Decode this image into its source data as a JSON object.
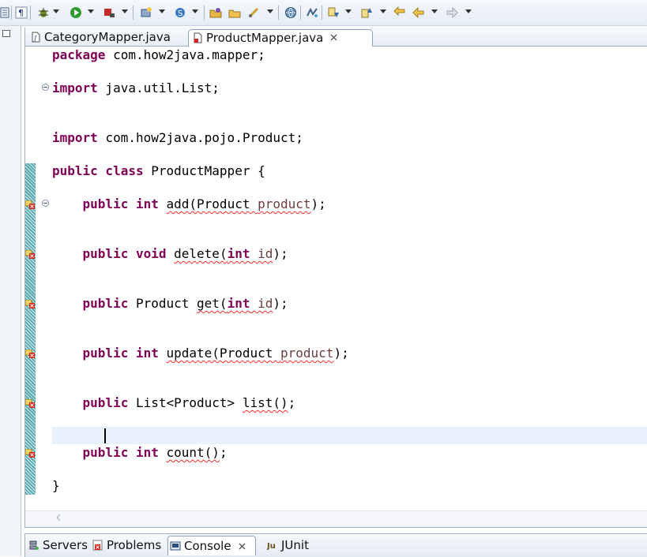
{
  "toolbar": {
    "icons": [
      "layout-icon",
      "paragraph-icon",
      "debug-icon",
      "run-icon",
      "run-external-icon",
      "new-server-icon",
      "new-class-icon",
      "open-type-icon",
      "open-folder-icon",
      "search-tool-icon",
      "web-browser-icon",
      "annotation-icon",
      "next-annotation-icon",
      "prev-annotation-icon",
      "back-icon",
      "forward-icon"
    ]
  },
  "editor": {
    "tabs": [
      {
        "label": "CategoryMapper.java",
        "active": false
      },
      {
        "label": "ProductMapper.java",
        "active": true
      }
    ],
    "code_lines": [
      {
        "text_a": "package",
        "text_b": " com.how2java.mapper;"
      },
      {
        "text_a": "import",
        "text_b": " java.util.List;"
      },
      {
        "text_a": "import",
        "text_b": " com.how2java.pojo.Product;"
      },
      {
        "text_a": "public class",
        "text_b": " ProductMapper {"
      },
      {
        "indent": "    ",
        "kw": "public int",
        "plain": " ",
        "method": "add(Product ",
        "param": "product",
        "tail": ");"
      },
      {
        "indent": "    ",
        "kw": "public void",
        "plain": " ",
        "method": "delete(",
        "kw2": "int",
        "param": " id",
        "tail": ");"
      },
      {
        "indent": "    ",
        "kw": "public",
        "plain": " Product ",
        "method": "get(",
        "kw2": "int",
        "param": " id",
        "tail": ");"
      },
      {
        "indent": "    ",
        "kw": "public int",
        "plain": " ",
        "method": "update(Product ",
        "param": "product",
        "tail": ");"
      },
      {
        "indent": "    ",
        "kw": "public",
        "plain": " List<Product> ",
        "method": "list()",
        "tail": ";"
      },
      {
        "indent": "    ",
        "kw": "public int",
        "plain": " ",
        "method": "count()",
        "tail": ";"
      },
      {
        "text_b": "}"
      }
    ]
  },
  "bottom_panel": {
    "tabs": [
      {
        "label": "Servers",
        "icon": "servers-icon",
        "active": false
      },
      {
        "label": "Problems",
        "icon": "problems-icon",
        "active": false
      },
      {
        "label": "Console",
        "icon": "console-icon",
        "active": true
      },
      {
        "label": "JUnit",
        "icon": "junit-icon",
        "active": false
      }
    ]
  },
  "colors": {
    "keyword": "#7f0055",
    "error_underline": "#ff2b2b",
    "current_line": "#e8f2fe",
    "quick_diff": "#5aa8b0"
  }
}
